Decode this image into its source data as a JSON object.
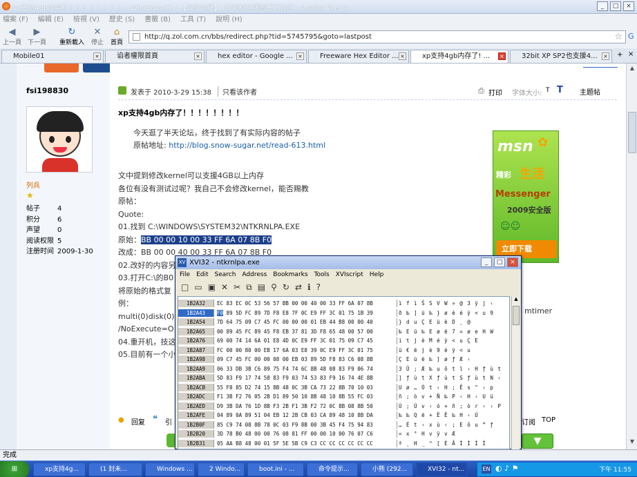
{
  "window_title": "xp支持4gb内存了！！！！！！！！ - Windows XP - 【软件论坛】_中关村在线图天下社区 - Mozilla Firefox",
  "menu": [
    "檔案 (F)",
    "編輯 (E)",
    "檢視 (V)",
    "歷史 (S)",
    "書籤 (B)",
    "工具 (T)",
    "說明 (H)"
  ],
  "nav": {
    "back": "上一頁",
    "forward": "下一頁",
    "reload": "重新載入",
    "stop": "停止",
    "home": "首頁"
  },
  "url": "http://q.zol.com.cn/bbs/redirect.php?tid=5745795&goto=lastpost",
  "tabs": [
    {
      "label": "Mobile01"
    },
    {
      "label": "谄者權限首頁"
    },
    {
      "label": "hex editor - Google ..."
    },
    {
      "label": "Freeware Hex Editor ..."
    },
    {
      "label": "xp支持4gb内存了! ..."
    },
    {
      "label": "32bit XP SP2也支援4..."
    }
  ],
  "user": {
    "name": "fsi198830",
    "rank": "列兵",
    "stats": [
      {
        "k": "帖子",
        "v": "4"
      },
      {
        "k": "积分",
        "v": "6"
      },
      {
        "k": "声望",
        "v": "0"
      },
      {
        "k": "阅读权限",
        "v": "5"
      },
      {
        "k": "注册时间",
        "v": "2009-1-30"
      }
    ]
  },
  "post": {
    "meta": "发表于 2010-3-29 15:38",
    "only_author": "只看该作者",
    "print": "打印",
    "font_size": "字体大小:",
    "font_t1": "T",
    "font_t2": "T",
    "topic_link": "主题帖",
    "title": "xp支持4gb内存了！！！！！！！！",
    "quote1": "今天逛了半天论坛，终于找到了有实际内容的帖子",
    "quote2_label": "原帖地址:",
    "quote2_link": "http://blog.snow-sugar.net/read-613.html",
    "l1": "文中提到修改kernel可以支援4GB以上内存",
    "l2": "各位有没有测试过呢？我自己不会修改kernel，能否赐教",
    "l3": "原帖：",
    "l4": "Quote:",
    "l5": "01.找到 C:\\WINDOWS\\SYSTEM32\\NTKRNLPA.EXE",
    "l6_label": "原始：",
    "l6_val": "BB 00 00 10 00 33 FF 6A 07 8B F0",
    "l7": "改成：BB 00 00 40 00 33 FF 6A 07 8B F0",
    "l8": "02.改好的内容另",
    "l9": "03.打开C:\\的B0",
    "l10": "将原始的格式复",
    "l11": "例：",
    "l12": "multi(0)disk(0)",
    "l12_tail": "mtimer",
    "l13": "/NoExecute=O",
    "l14": "04.重开机，技这",
    "l15": "05.目前有一个小",
    "reply": "回复",
    "quote_btn": "引",
    "subscribe": "订阅",
    "top": "TOP"
  },
  "ad": {
    "brand": "msn",
    "tag": "精彩",
    "sub": "生活",
    "app": "Messenger",
    "ver": "2009安全版",
    "cta": "立即下载"
  },
  "status": "完成",
  "xvi": {
    "title": "XVI32 - ntkrnlpa.exe",
    "menu": [
      "File",
      "Edit",
      "Search",
      "Address",
      "Bookmarks",
      "Tools",
      "XVIscript",
      "Help"
    ],
    "rows": [
      {
        "a": "1B2A32",
        "h": "EC 83 EC 0C 53 56 57 BB 00 00 40 00 33 FF 6A 07 8B",
        "c": "ì f ì Ŝ S V W » @ 3 ÿ j ‹"
      },
      {
        "a": "1B2A43",
        "h": "F0 89 5D FC 89 7D F8 E8 7F 0C E9 FF 3C 01 75 1B 39",
        "c": "ð ‰ ] ü ‰ } ø è é ÿ < u 9"
      },
      {
        "a": "1B2A54",
        "h": "7D 64 75 09 C7 45 FC 00 00 00 01 EB 44 B8 00 00 40",
        "c": "} d u Ç E ü ë D ¸ @"
      },
      {
        "a": "1B2A65",
        "h": "00 89 45 FC 89 45 F8 EB 37 81 3D F8 65 48 00 57 00",
        "c": "‰ E ü ‰ E ø ë 7 = ø e H W"
      },
      {
        "a": "1B2A76",
        "h": "69 00 74 14 6A 01 E8 4D 0C E9 FF 3C 01 75 09 C7 45",
        "c": "i t j è M é ÿ < u Ç E"
      },
      {
        "a": "1B2A87",
        "h": "FC 00 00 80 00 EB 17 6A 03 E8 39 0C E9 FF 3C 01 75",
        "c": "ü € ë j è 9 é ÿ < u"
      },
      {
        "a": "1B2A98",
        "h": "09 C7 45 FC 00 00 08 00 EB 03 89 5D F8 83 C6 08 8B",
        "c": "Ç E ü ë ‰ ] ø ƒ Æ ‹"
      },
      {
        "a": "1B2AA9",
        "h": "06 33 DB 3B C6 89 75 F4 74 6C 8B 48 08 83 F9 06 74",
        "c": "3 Û ; Æ ‰ u ô t l ‹ H ƒ ù t"
      },
      {
        "a": "1B2ABA",
        "h": "5D 83 F9 17 74 58 83 F9 03 74 53 83 F9 16 74 4E 8B",
        "c": "] ƒ ù t X ƒ ù t S ƒ ù t N ‹"
      },
      {
        "a": "1B2ACB",
        "h": "55 F8 85 D2 74 15 8B 48 0C 3B CA 73 22 8B 70 10 03",
        "c": "U ø … Ò t ‹ H ; Ê s \" ‹ p"
      },
      {
        "a": "1B2ADC",
        "h": "F1 3B F2 76 05 2B D1 89 50 10 8B 48 10 8B 55 FC 03",
        "c": "ñ ; ò v + Ñ ‰ P ‹ H ‹ U ü"
      },
      {
        "a": "1B2AED",
        "h": "D9 3B DA 76 1D 8B F3 2B F1 3B F2 72 0C 8B 08 8B 50",
        "c": "Ù ; Ú v ‹ ó + ñ ; ò r ‹ ‹ P"
      },
      {
        "a": "1B2AFE",
        "h": "04 89 0A 89 51 04 EB 12 2B CB 03 CA 89 48 10 8B DA",
        "c": "‰ ‰ Q ë + Ë Ê ‰ H ‹ Ú"
      },
      {
        "a": "1B2B0F",
        "h": "85 C9 74 08 8B 78 0C 03 F9 8B 00 3B 45 F4 75 94 83",
        "c": "… É t ‹ x ù ‹ ; E ô u ” ƒ"
      },
      {
        "a": "1B2B20",
        "h": "3D 78 B0 48 00 00 76 08 81 FF 00 00 10 00 76 07 C6",
        "c": "= x ° H v ÿ v Æ"
      },
      {
        "a": "1B2B31",
        "h": "05 AA B8 48 00 01 5F 5E 5B C9 C3 CC CC CC CC CC CC",
        "c": "ª ¸ H _ ^ [ É Ã Ì Ì Ì Ì"
      }
    ]
  },
  "taskbar": {
    "start": "开始",
    "items": [
      "xp支持4g...",
      "(1 封未...",
      "Windows ...",
      "2 Windo...",
      "boot.ini - ...",
      "命令提示...",
      "小熊 (292...",
      "XVI32 - nt..."
    ],
    "lang": "EN",
    "time": "下午 11:55"
  }
}
